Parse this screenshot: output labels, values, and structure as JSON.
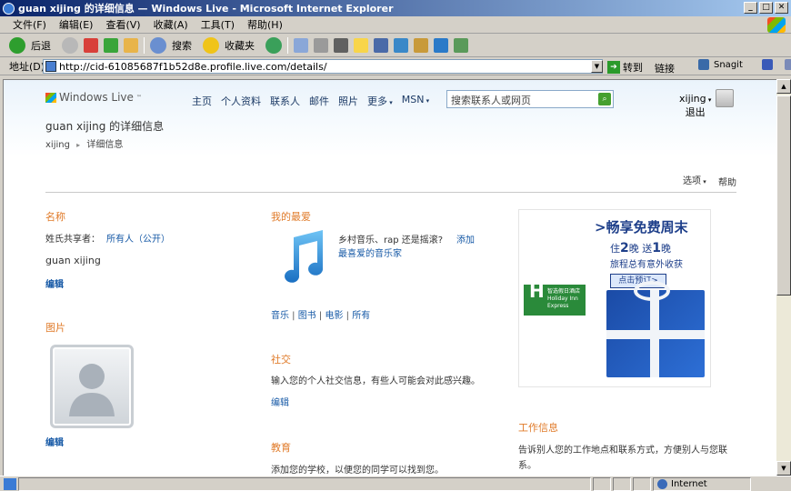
{
  "window": {
    "title": "guan xijing 的详细信息 — Windows Live - Microsoft Internet Explorer"
  },
  "menu": [
    "文件(F)",
    "编辑(E)",
    "查看(V)",
    "收藏(A)",
    "工具(T)",
    "帮助(H)"
  ],
  "toolbar": {
    "back": "后退",
    "search": "搜索",
    "favorites": "收藏夹"
  },
  "address": {
    "label": "地址(D)",
    "url": "http://cid-61085687f1b52d8e.profile.live.com/details/",
    "go": "转到",
    "links": "链接",
    "snagit": "Snagit"
  },
  "status": {
    "zone": "Internet"
  },
  "site": {
    "logo": "Windows Live",
    "logo_tm": "™"
  },
  "nav": [
    "主页",
    "个人资料",
    "联系人",
    "邮件",
    "照片",
    "更多",
    "MSN"
  ],
  "search": {
    "placeholder": "搜索联系人或网页"
  },
  "user": {
    "name": "xijing",
    "signout": "退出"
  },
  "page": {
    "title": "guan xijing 的详细信息",
    "crumb_user": "xijing",
    "crumb_sep": "▸",
    "crumb_page": "详细信息"
  },
  "options": {
    "label": "选项",
    "help": "帮助"
  },
  "name_section": {
    "heading": "名称",
    "share_label": "姓氏共享者：",
    "share_value": "所有人（公开）",
    "name": "guan xijing",
    "edit": "编辑"
  },
  "photo_section": {
    "heading": "图片",
    "edit": "编辑"
  },
  "favorites": {
    "heading": "我的最爱",
    "prompt": "乡村音乐、rap 还是摇滚?",
    "add_link": "添加",
    "add_link2": "最喜爱的音乐家",
    "tabs": [
      "音乐",
      "图书",
      "电影",
      "所有"
    ]
  },
  "social": {
    "heading": "社交",
    "desc": "输入您的个人社交信息，有些人可能会对此感兴趣。",
    "edit": "编辑"
  },
  "education": {
    "heading": "教育",
    "desc": "添加您的学校，以便您的同学可以找到您。"
  },
  "work": {
    "heading": "工作信息",
    "desc": "告诉别人您的工作地点和联系方式，方便别人与您联",
    "desc2": "系。"
  },
  "ad": {
    "title": ">畅享免费周末",
    "line1_a": "住",
    "line1_num1": "2",
    "line1_b": "晚  送",
    "line1_num2": "1",
    "line1_c": "晚",
    "line2": "旅程总有意外收获",
    "button": "点击预订>",
    "brand": "Holiday Inn Express",
    "brand_cn": "智选假日酒店"
  }
}
